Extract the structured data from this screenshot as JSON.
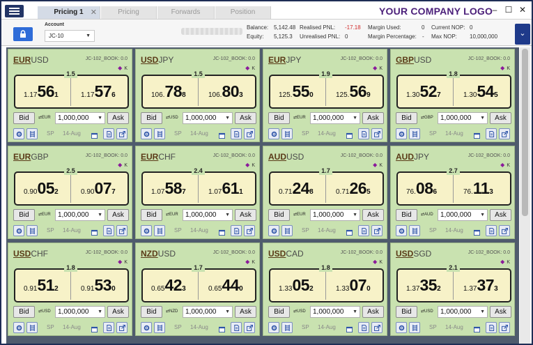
{
  "tabs": [
    {
      "label": "Pricing 1",
      "active": true,
      "close": "✕"
    },
    {
      "label": "Pricing",
      "active": false
    },
    {
      "label": "Forwards",
      "active": false
    },
    {
      "label": "Position",
      "active": false
    }
  ],
  "logo": "YOUR COMPANY LOGO",
  "window_controls": {
    "minimize": "–",
    "maximize": "☐",
    "close": "✕"
  },
  "account": {
    "label": "Account",
    "value": "JC-10"
  },
  "stats": {
    "balance_label": "Balance:",
    "balance": "5,142.48",
    "equity_label": "Equity:",
    "equity": "5,125.3",
    "realised_label": "Realised PNL:",
    "realised": "-17.18",
    "unrealised_label": "Unrealised PNL:",
    "unrealised": "0",
    "margin_used_label": "Margin Used:",
    "margin_used": "0",
    "margin_pct_label": "Margin Percentage:",
    "margin_pct": "-",
    "current_nop_label": "Current NOP:",
    "current_nop": "0",
    "max_nop_label": "Max NOP:",
    "max_nop": "10,000,000"
  },
  "colors": {
    "accent": "#2f6cd8",
    "navy": "#233566",
    "tile_bg": "#c9e2b0",
    "price_bg": "#f7f2c8",
    "red": "#d12b2b",
    "logo": "#4b1f7a"
  },
  "tile_common": {
    "book": "JC-102_BOOK: 0.0",
    "k": "K",
    "bid": "Bid",
    "ask": "Ask",
    "sp": "SP",
    "date": "14-Aug",
    "amount": "1,000,000"
  },
  "tiles": [
    {
      "base": "EUR",
      "quote": "USD",
      "spread": "1.5",
      "ccy": "EUR",
      "bid_pre": "1.17",
      "bid_big": "56",
      "bid_pip": "1",
      "ask_pre": "1.17",
      "ask_big": "57",
      "ask_pip": "6"
    },
    {
      "base": "USD",
      "quote": "JPY",
      "spread": "1.5",
      "ccy": "USD",
      "bid_pre": "106.",
      "bid_big": "78",
      "bid_pip": "8",
      "ask_pre": "106.",
      "ask_big": "80",
      "ask_pip": "3"
    },
    {
      "base": "EUR",
      "quote": "JPY",
      "spread": "1.9",
      "ccy": "EUR",
      "bid_pre": "125.",
      "bid_big": "55",
      "bid_pip": "0",
      "ask_pre": "125.",
      "ask_big": "56",
      "ask_pip": "9"
    },
    {
      "base": "GBP",
      "quote": "USD",
      "spread": "1.8",
      "ccy": "GBP",
      "bid_pre": "1.30",
      "bid_big": "52",
      "bid_pip": "7",
      "ask_pre": "1.30",
      "ask_big": "54",
      "ask_pip": "5"
    },
    {
      "base": "EUR",
      "quote": "GBP",
      "spread": "2.5",
      "ccy": "EUR",
      "bid_pre": "0.90",
      "bid_big": "05",
      "bid_pip": "2",
      "ask_pre": "0.90",
      "ask_big": "07",
      "ask_pip": "7"
    },
    {
      "base": "EUR",
      "quote": "CHF",
      "spread": "2.4",
      "ccy": "EUR",
      "bid_pre": "1.07",
      "bid_big": "58",
      "bid_pip": "7",
      "ask_pre": "1.07",
      "ask_big": "61",
      "ask_pip": "1"
    },
    {
      "base": "AUD",
      "quote": "USD",
      "spread": "1.7",
      "ccy": "EUR",
      "bid_pre": "0.71",
      "bid_big": "24",
      "bid_pip": "8",
      "ask_pre": "0.71",
      "ask_big": "26",
      "ask_pip": "5"
    },
    {
      "base": "AUD",
      "quote": "JPY",
      "spread": "2.7",
      "ccy": "AUD",
      "bid_pre": "76.",
      "bid_big": "08",
      "bid_pip": "6",
      "ask_pre": "76.",
      "ask_big": "11",
      "ask_pip": "3"
    },
    {
      "base": "USD",
      "quote": "CHF",
      "spread": "1.8",
      "ccy": "USD",
      "bid_pre": "0.91",
      "bid_big": "51",
      "bid_pip": "2",
      "ask_pre": "0.91",
      "ask_big": "53",
      "ask_pip": "0"
    },
    {
      "base": "NZD",
      "quote": "USD",
      "spread": "1.7",
      "ccy": "NZD",
      "bid_pre": "0.65",
      "bid_big": "42",
      "bid_pip": "3",
      "ask_pre": "0.65",
      "ask_big": "44",
      "ask_pip": "0"
    },
    {
      "base": "USD",
      "quote": "CAD",
      "spread": "1.8",
      "ccy": "USD",
      "bid_pre": "1.33",
      "bid_big": "05",
      "bid_pip": "2",
      "ask_pre": "1.33",
      "ask_big": "07",
      "ask_pip": "0"
    },
    {
      "base": "USD",
      "quote": "SGD",
      "spread": "2.1",
      "ccy": "USD",
      "bid_pre": "1.37",
      "bid_big": "35",
      "bid_pip": "2",
      "ask_pre": "1.37",
      "ask_big": "37",
      "ask_pip": "3"
    }
  ]
}
